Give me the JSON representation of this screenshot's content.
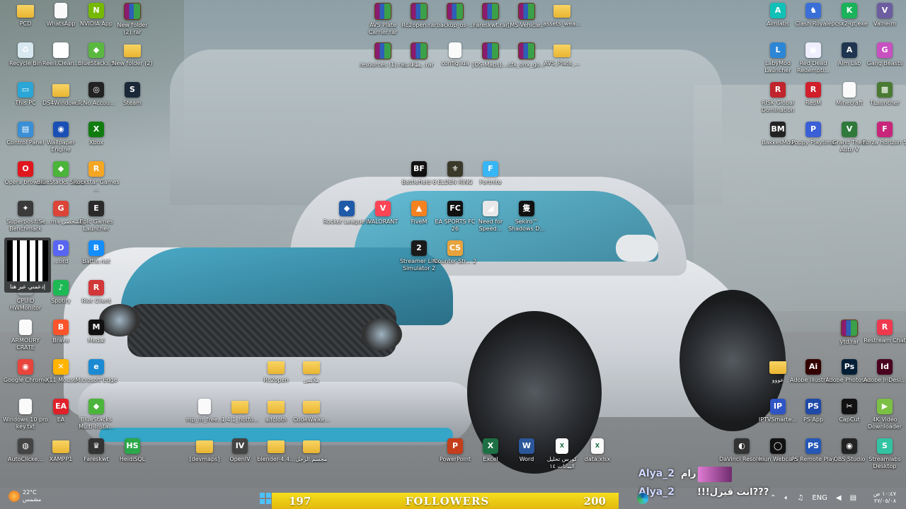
{
  "desktop": {
    "icons": [
      {
        "label": "PCD",
        "type": "folder",
        "glyph": ""
      },
      {
        "label": "WhatsApp",
        "type": "file",
        "glyph": ""
      },
      {
        "label": "NVIDIA App",
        "type": "app",
        "glyph": "N",
        "color": "#76b900"
      },
      {
        "label": "New folder (2).rar",
        "type": "rar",
        "glyph": ""
      },
      {
        "label": "Recycle Bin",
        "type": "app",
        "glyph": "♻",
        "color": "#d8e8f0"
      },
      {
        "label": "Reeii.Clean...",
        "type": "app",
        "glyph": "▦",
        "color": "#ffffff"
      },
      {
        "label": "BlueStacks 5",
        "type": "app",
        "glyph": "◆",
        "color": "#5ab83f"
      },
      {
        "label": "New folder (2)",
        "type": "folder",
        "glyph": ""
      },
      {
        "label": "This PC",
        "type": "app",
        "glyph": "▭",
        "color": "#2aa7d6"
      },
      {
        "label": "DS4Windows",
        "type": "folder",
        "glyph": ""
      },
      {
        "label": "TcNo Accou...",
        "type": "app",
        "glyph": "◎",
        "color": "#222"
      },
      {
        "label": "Steam",
        "type": "app",
        "glyph": "S",
        "color": "#1b2838"
      },
      {
        "label": "Control Panel",
        "type": "app",
        "glyph": "▤",
        "color": "#3a8fd6"
      },
      {
        "label": "Wallpaper Engine",
        "type": "app",
        "glyph": "◉",
        "color": "#1a4fb5"
      },
      {
        "label": "Xbox",
        "type": "app",
        "glyph": "X",
        "color": "#107c10"
      },
      {
        "label": "Opera browser",
        "type": "app",
        "glyph": "O",
        "color": "#e0161d"
      },
      {
        "label": "BlueStacks Store",
        "type": "app",
        "glyph": "◆",
        "color": "#4bb43a"
      },
      {
        "label": "Rockstar Games ...",
        "type": "app",
        "glyph": "R",
        "color": "#f5a623"
      },
      {
        "label": "Superpositi... Benchmark",
        "type": "app",
        "glyph": "✦",
        "color": "#3a3a3a"
      },
      {
        "label": "Se...ma الشخصي",
        "type": "app",
        "glyph": "G",
        "color": "#db4437"
      },
      {
        "label": "Epic Games Launcher",
        "type": "app",
        "glyph": "E",
        "color": "#2a2a2a"
      },
      {
        "label": "...ord",
        "type": "app",
        "glyph": "D",
        "color": "#5865f2"
      },
      {
        "label": "Battle.net",
        "type": "app",
        "glyph": "B",
        "color": "#148eff"
      },
      {
        "label": "Spotify",
        "type": "app",
        "glyph": "♪",
        "color": "#1db954"
      },
      {
        "label": "Riot Client",
        "type": "app",
        "glyph": "R",
        "color": "#d13639"
      },
      {
        "label": "CPUID HWMonitor",
        "type": "app",
        "glyph": "",
        "color": "rgba(0,0,0,0)"
      },
      {
        "label": "ARMOURY CRATE",
        "type": "file",
        "glyph": ""
      },
      {
        "label": "Brave",
        "type": "app",
        "glyph": "B",
        "color": "#fb542b"
      },
      {
        "label": "Medal",
        "type": "app",
        "glyph": "M",
        "color": "#111"
      },
      {
        "label": "Google Chrome",
        "type": "app",
        "glyph": "◉",
        "color": "#e8453c"
      },
      {
        "label": "X11 Mouse",
        "type": "app",
        "glyph": "✕",
        "color": "#ffb400"
      },
      {
        "label": "Microsoft Edge",
        "type": "app",
        "glyph": "e",
        "color": "#1b8ad2"
      },
      {
        "label": "Windows 10 pro key.txt",
        "type": "file",
        "glyph": ""
      },
      {
        "label": "EA",
        "type": "app",
        "glyph": "EA",
        "color": "#e1202a"
      },
      {
        "label": "BlueStacks Multi-Insta...",
        "type": "app",
        "glyph": "◆",
        "color": "#4bb43a"
      },
      {
        "label": "AutoClicke...",
        "type": "app",
        "glyph": "◍",
        "color": "#444"
      },
      {
        "label": "XAMPP1",
        "type": "folder",
        "glyph": ""
      },
      {
        "label": "Fareskwt",
        "type": "app",
        "glyph": "♛",
        "color": "#333"
      },
      {
        "label": "HeidiSQL",
        "type": "app",
        "glyph": "HS",
        "color": "#2aa84a"
      },
      {
        "label": "[devmaps]",
        "type": "folder",
        "glyph": ""
      },
      {
        "label": "OpenIV",
        "type": "app",
        "glyph": "IV",
        "color": "#444"
      },
      {
        "label": "blender-4.4...",
        "type": "folder",
        "glyph": ""
      },
      {
        "label": "مجسم الرجل",
        "type": "folder",
        "glyph": ""
      },
      {
        "label": "PowerPoint",
        "type": "app",
        "glyph": "P",
        "color": "#c43e1c"
      },
      {
        "label": "Excel",
        "type": "app",
        "glyph": "X",
        "color": "#1d7044"
      },
      {
        "label": "Word",
        "type": "app",
        "glyph": "W",
        "color": "#2b579a"
      },
      {
        "label": "كورس تحليل البيانات ١٤",
        "type": "file",
        "glyph": "X"
      },
      {
        "label": "data.xlsx",
        "type": "file",
        "glyph": "X"
      },
      {
        "label": "AVS Plate Carrier.rar",
        "type": "rar",
        "glyph": ""
      },
      {
        "label": "Rc2open.rar",
        "type": "rar",
        "glyph": ""
      },
      {
        "label": "backup_os-...",
        "type": "rar",
        "glyph": ""
      },
      {
        "label": "Fareskwt.rar",
        "type": "rar",
        "glyph": ""
      },
      {
        "label": "[MS-Vehicle...",
        "type": "rar",
        "glyph": ""
      },
      {
        "label": "assets_wea...",
        "type": "folder",
        "glyph": ""
      },
      {
        "label": "resources (1).rar",
        "type": "rar",
        "glyph": ""
      },
      {
        "label": "بطاقات .rar",
        "type": "rar",
        "glyph": ""
      },
      {
        "label": "config.lua",
        "type": "file",
        "glyph": ""
      },
      {
        "label": "[OS-Maps]....",
        "type": "rar",
        "glyph": ""
      },
      {
        "label": "cfx_onx_go...",
        "type": "rar",
        "glyph": ""
      },
      {
        "label": "AVS_Plate_...",
        "type": "folder",
        "glyph": ""
      },
      {
        "label": "Battlefield 6",
        "type": "app",
        "glyph": "BF",
        "color": "#111"
      },
      {
        "label": "ELDEN RING",
        "type": "app",
        "glyph": "⚜",
        "color": "#3b3a2a"
      },
      {
        "label": "Fortnite",
        "type": "app",
        "glyph": "F",
        "color": "#37b6f6"
      },
      {
        "label": "Rocket League®",
        "type": "app",
        "glyph": "◆",
        "color": "#1f5aa8"
      },
      {
        "label": "VALORANT",
        "type": "app",
        "glyph": "V",
        "color": "#fd4556"
      },
      {
        "label": "FiveM",
        "type": "app",
        "glyph": "▲",
        "color": "#f58220"
      },
      {
        "label": "EA SPORTS FC 26",
        "type": "app",
        "glyph": "FC",
        "color": "#111"
      },
      {
        "label": "Need for Speed...",
        "type": "app",
        "glyph": "◢",
        "color": "#e8e8e8"
      },
      {
        "label": "Sekiro™ Shadows D...",
        "type": "app",
        "glyph": "隻",
        "color": "#111"
      },
      {
        "label": "Streamer Life Simulator 2",
        "type": "app",
        "glyph": "2",
        "color": "#1a1a1a"
      },
      {
        "label": "Counter-Str... 2",
        "type": "app",
        "glyph": "CS",
        "color": "#e8a33d"
      },
      {
        "label": "Rc2open",
        "type": "folder",
        "glyph": ""
      },
      {
        "label": "ملابس",
        "type": "folder",
        "glyph": ""
      },
      {
        "label": "mp_m_free...",
        "type": "file",
        "glyph": ""
      },
      {
        "label": "1.4.1_hotfo...",
        "type": "folder",
        "glyph": ""
      },
      {
        "label": "altcloth",
        "type": "folder",
        "glyph": ""
      },
      {
        "label": "CodeWalke...",
        "type": "folder",
        "glyph": ""
      },
      {
        "label": "Aimlabs",
        "type": "app",
        "glyph": "A",
        "color": "#10c1b7"
      },
      {
        "label": "Clash Royale",
        "type": "app",
        "glyph": "♞",
        "color": "#3a6fd8"
      },
      {
        "label": "pcsx2-qt.exe",
        "type": "app",
        "glyph": "K",
        "color": "#19b35a"
      },
      {
        "label": "Valheim",
        "type": "app",
        "glyph": "V",
        "color": "#6c5da0"
      },
      {
        "label": "LabyMod Launcher",
        "type": "app",
        "glyph": "L",
        "color": "#2c86d6"
      },
      {
        "label": "Red Dead Redempti...",
        "type": "app",
        "glyph": "▣",
        "color": "#eef"
      },
      {
        "label": "Aim Lab",
        "type": "app",
        "glyph": "A",
        "color": "#1f3550"
      },
      {
        "label": "Gang Beasts",
        "type": "app",
        "glyph": "G",
        "color": "#c850c0"
      },
      {
        "label": "RISK Global Domination",
        "type": "app",
        "glyph": "R",
        "color": "#c0242c"
      },
      {
        "label": "RedM",
        "type": "app",
        "glyph": "R",
        "color": "#d11f2b"
      },
      {
        "label": "Minecraft",
        "type": "file",
        "glyph": ""
      },
      {
        "label": "TLauncher",
        "type": "app",
        "glyph": "▩",
        "color": "#4a7a32"
      },
      {
        "label": "BakkesMod",
        "type": "app",
        "glyph": "BM",
        "color": "#222"
      },
      {
        "label": "Poppy Playtime",
        "type": "app",
        "glyph": "P",
        "color": "#3a5fd6"
      },
      {
        "label": "Grand Theft Auto V",
        "type": "app",
        "glyph": "V",
        "color": "#2f7a3a"
      },
      {
        "label": "Forza Horizon 5",
        "type": "app",
        "glyph": "F",
        "color": "#c8267a"
      },
      {
        "label": "ytd.rar",
        "type": "rar",
        "glyph": ""
      },
      {
        "label": "Restream Chat",
        "type": "app",
        "glyph": "R",
        "color": "#f0394f"
      },
      {
        "label": "عووو",
        "type": "folder",
        "glyph": ""
      },
      {
        "label": "Adobe Illustrat...",
        "type": "app",
        "glyph": "Ai",
        "color": "#330000"
      },
      {
        "label": "Adobe Photosh...",
        "type": "app",
        "glyph": "Ps",
        "color": "#001e36"
      },
      {
        "label": "Adobe InDesi...",
        "type": "app",
        "glyph": "Id",
        "color": "#49021f"
      },
      {
        "label": "IPTVSmarte...",
        "type": "app",
        "glyph": "IP",
        "color": "#2f55c5"
      },
      {
        "label": "PS App",
        "type": "app",
        "glyph": "PS",
        "color": "#1f4aa8"
      },
      {
        "label": "CapCut",
        "type": "app",
        "glyph": "✂",
        "color": "#111"
      },
      {
        "label": "4K Video Downloader",
        "type": "app",
        "glyph": "▶",
        "color": "#7bc043"
      },
      {
        "label": "DaVinci Resolve",
        "type": "app",
        "glyph": "◐",
        "color": "#333"
      },
      {
        "label": "Iriun Webcam",
        "type": "app",
        "glyph": "◯",
        "color": "#111"
      },
      {
        "label": "PS Remote Play",
        "type": "app",
        "glyph": "PS",
        "color": "#2557b6"
      },
      {
        "label": "OBS Studio",
        "type": "app",
        "glyph": "◉",
        "color": "#222"
      },
      {
        "label": "Streamlabs Desktop",
        "type": "app",
        "glyph": "S",
        "color": "#31c3a2"
      }
    ],
    "qr_label": "إدعمني عبر هنا"
  },
  "stream": {
    "user1": "Alya_2",
    "msg1": "رام",
    "user2": "Alya_2",
    "msg2": "!!!انت قيرل???",
    "followers_current": "197",
    "followers_label": "FOLLOWERS",
    "followers_goal": "200"
  },
  "taskbar": {
    "weather_temp": "22°C",
    "weather_desc": "مشمس",
    "lang": "ENG",
    "time": "١٠:٤٧ ص",
    "date": "٢٧/٠٥/٠٨"
  },
  "colors": {
    "accent": "#4cc2ff",
    "follower_bar": "#f6de1e",
    "username": "#cfd6ff"
  }
}
